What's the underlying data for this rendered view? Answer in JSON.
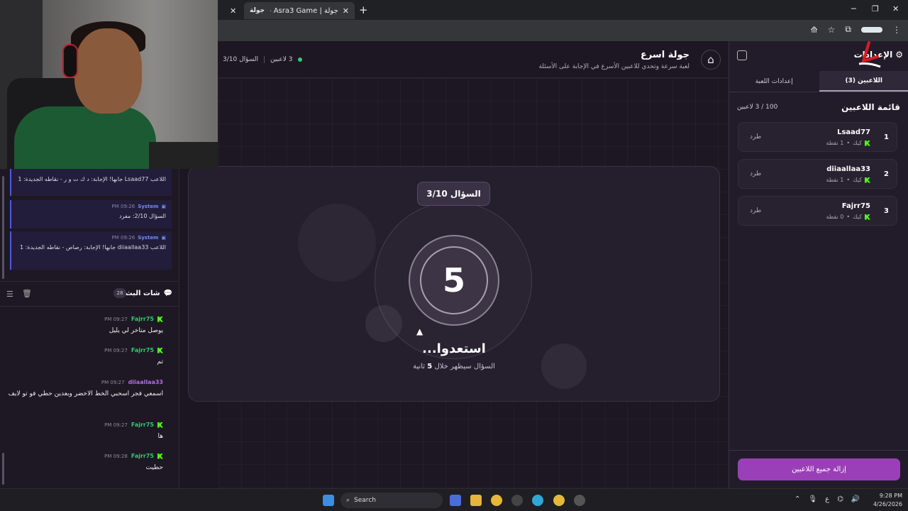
{
  "browser": {
    "inactive_tab_close": "✕",
    "tab_favicon": "جولة",
    "tab_title": "جولة | Asra3 Game - جولة اسرع",
    "tab_close": "✕",
    "new_tab": "+",
    "win_min": "─",
    "win_max": "❐",
    "win_close": "✕"
  },
  "game": {
    "title": "جولة اسرع",
    "subtitle": "لعبة سرعة وتحدي للاعبين الأسرع في الإجابة على الأسئلة",
    "players_online": "3 لاعبين",
    "question_progress": "السؤال 3/10",
    "question_badge": "السؤال 3/10",
    "countdown": "5",
    "ready_text": "استعدوا...",
    "ready_sub_prefix": "السؤال سيظهر خلال",
    "ready_sub_num": "5",
    "ready_sub_suffix": "ثانية"
  },
  "settings": {
    "title": "الإعدادات",
    "tabs": [
      {
        "label": "اللاعبين (3)",
        "active": true
      },
      {
        "label": "إعدادات اللعبة",
        "active": false
      }
    ],
    "players_header": "قائمة اللاعبين",
    "players_count": "100 / 3 لاعبين",
    "players": [
      {
        "rank": "1",
        "name": "Lsaad77",
        "platform": "كيك",
        "points": "1 نقطة",
        "kick": "طرد"
      },
      {
        "rank": "2",
        "name": "diiaallaa33",
        "platform": "كيك",
        "points": "1 نقطة",
        "kick": "طرد"
      },
      {
        "rank": "3",
        "name": "Fajrr75",
        "platform": "كيك",
        "points": "0 نقطة",
        "kick": "طرد"
      }
    ],
    "remove_all": "إزالة جميع اللاعبين"
  },
  "system_log": [
    {
      "sender": "",
      "time": "",
      "text": "اللاعب Lsaad77 جابها! الإجابة: د ك ت و ر - نقاطه الجديدة: 1"
    },
    {
      "sender": "System",
      "time": "09:26 PM",
      "text": "السؤال 2/10: مفرد"
    },
    {
      "sender": "System",
      "time": "09:26 PM",
      "text": "اللاعب diiaallaa33 جابها! الإجابة: رصاص - نقاطه الجديدة: 1"
    }
  ],
  "chat": {
    "title": "شات البث",
    "count": "28",
    "messages": [
      {
        "user": "Fajrr75",
        "time": "09:27 PM",
        "text": "يوصل متاخر لي يليل",
        "color": "#2ecc71"
      },
      {
        "user": "Fajrr75",
        "time": "09:27 PM",
        "text": "تم",
        "color": "#2ecc71"
      },
      {
        "user": "diiaallaa33",
        "time": "09:27 PM",
        "text": "اسمعي فجر اسحبي الخط الاخضر وبعدين حطي فو تو لايف",
        "color": "#b46ee6"
      },
      {
        "user": "Fajrr75",
        "time": "09:27 PM",
        "text": "ها",
        "color": "#2ecc71"
      },
      {
        "user": "Fajrr75",
        "time": "09:28 PM",
        "text": "حطيت",
        "color": "#2ecc71"
      }
    ]
  },
  "taskbar": {
    "search": "Search",
    "ime": "ع",
    "time": "9:28 PM",
    "date": "4/26/2026"
  },
  "colors": {
    "accent_purple": "#9b3fb8",
    "kick_green": "#53fc18",
    "online_green": "#2ecc71"
  }
}
